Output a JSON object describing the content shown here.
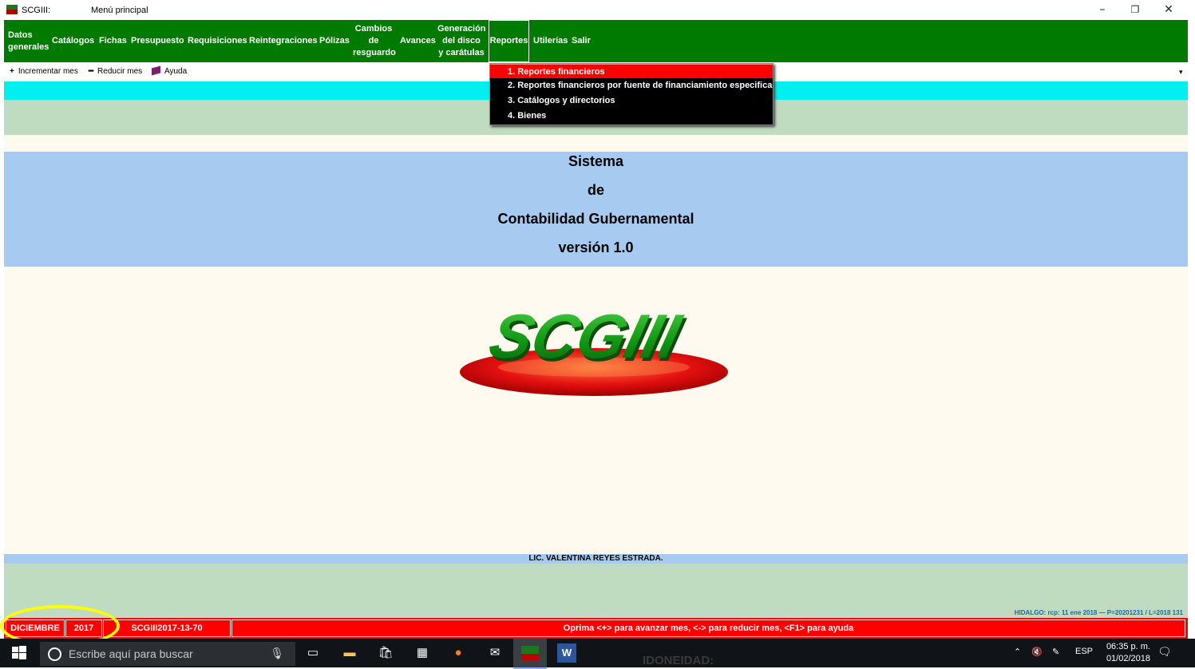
{
  "window": {
    "app_title": "SCGIII:",
    "window_title": "Menú principal",
    "min": "–",
    "restore": "❐",
    "close": "✕"
  },
  "menu": {
    "items": [
      {
        "l1": "Datos",
        "l2": "generales"
      },
      {
        "label": "Catálogos"
      },
      {
        "label": "Fichas"
      },
      {
        "label": "Presupuesto"
      },
      {
        "label": "Requisiciones"
      },
      {
        "label": "Reintegraciones"
      },
      {
        "label": "Pólizas"
      },
      {
        "l1": "Cambios",
        "l2": "de",
        "l3": "resguardo"
      },
      {
        "label": "Avances"
      },
      {
        "l1": "Generación",
        "l2": "del disco",
        "l3": "y carátulas"
      },
      {
        "label": "Reportes"
      },
      {
        "label": "Utilerías"
      },
      {
        "label": "Salir"
      }
    ]
  },
  "dropdown": {
    "items": [
      "1. Reportes financieros",
      "2. Reportes financieros por fuente de financiamiento especifica",
      "3. Catálogos y directorios",
      "4. Bienes"
    ],
    "active_index": 0
  },
  "toolbar": {
    "inc_icon": "+",
    "inc_label": "Incrementar mes",
    "red_icon": "━",
    "red_label": "Reducir mes",
    "help_label": "Ayuda",
    "arrow": "▾"
  },
  "main": {
    "lines": [
      "Sistema",
      "de",
      "Contabilidad Gubernamental",
      "versión 1.0"
    ],
    "logo_text": "SCGIII",
    "signature": "LIC. VALENTINA REYES ESTRADA.",
    "right_info": "HIDALGO: rcp: 11 ene 2018 —   P=20201231 / L=2018 131"
  },
  "status": {
    "month": "DICIEMBRE",
    "year": "2017",
    "code": "SCGIII2017-13-70",
    "message": "Oprima <+> para avanzar mes, <-> para reducir mes, <F1> para ayuda"
  },
  "taskbar": {
    "search_placeholder": "Escribe aquí para buscar",
    "language": "ESP",
    "time": "06:35 p. m.",
    "date": "01/02/2018",
    "background_text": "IDONEIDAD:"
  },
  "colors": {
    "menu_green": "#007a00",
    "status_red": "#ff0000",
    "accent_cyan": "#00f0f0",
    "panel_blue": "#a6caf0",
    "highlight": "#ffff00"
  }
}
